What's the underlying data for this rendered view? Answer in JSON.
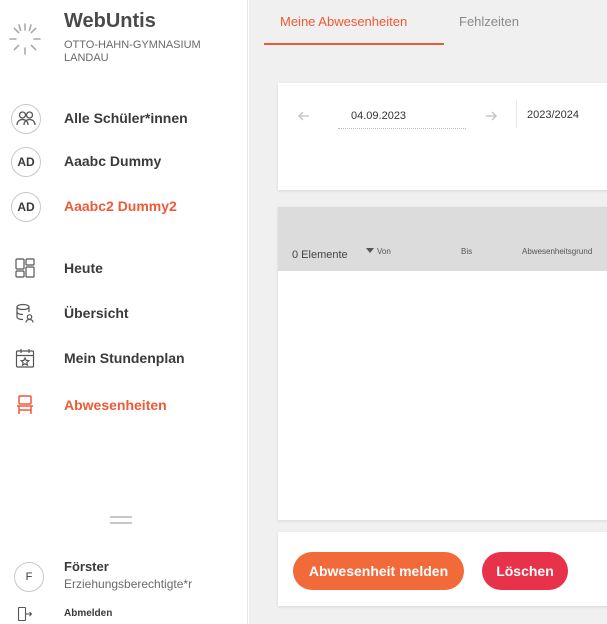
{
  "brand": {
    "title": "WebUntis",
    "school": "OTTO-HAHN-GYMNASIUM LANDAU"
  },
  "users": [
    {
      "initials": "",
      "label": "Alle Schüler*innen",
      "active": false
    },
    {
      "initials": "AD",
      "label": "Aaabc Dummy",
      "active": false
    },
    {
      "initials": "AD",
      "label": "Aaabc2 Dummy2",
      "active": true
    }
  ],
  "nav": [
    {
      "label": "Heute",
      "icon": "dashboard-icon",
      "active": false
    },
    {
      "label": "Übersicht",
      "icon": "overview-icon",
      "active": false
    },
    {
      "label": "Mein Stundenplan",
      "icon": "calendar-icon",
      "active": false
    },
    {
      "label": "Abwesenheiten",
      "icon": "chair-icon",
      "active": true
    }
  ],
  "profile": {
    "initial": "F",
    "name": "Förster",
    "role": "Erziehungsberechtigte*r"
  },
  "logout": {
    "label": "Abmelden"
  },
  "tabs": [
    {
      "label": "Meine Abwesenheiten",
      "active": true
    },
    {
      "label": "Fehlzeiten",
      "active": false
    }
  ],
  "filter": {
    "date": "04.09.2023",
    "school_year": "2023/2024"
  },
  "table": {
    "columns": [
      "Von",
      "Bis",
      "Abwesenheitsgrund"
    ],
    "count": "0 Elemente"
  },
  "actions": {
    "report": "Abwesenheit melden",
    "delete": "Löschen"
  },
  "colors": {
    "accent": "#ef5a36",
    "primary_button": "#f26a3a",
    "danger_button": "#e8324a",
    "background": "#f0f0f0"
  }
}
